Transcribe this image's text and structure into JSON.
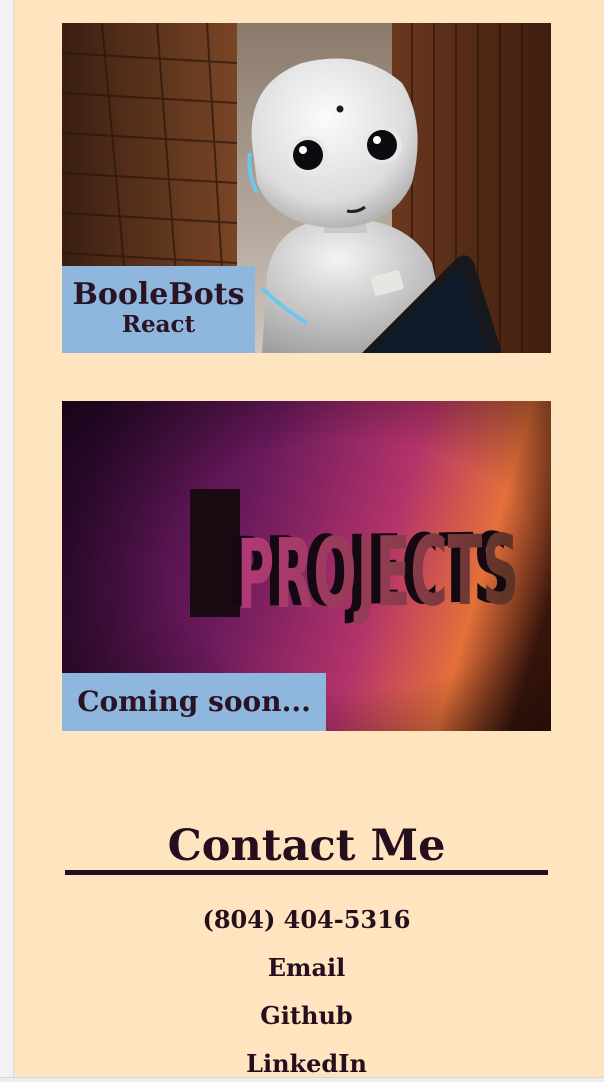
{
  "projects": [
    {
      "title": "BooleBots",
      "subtitle": "React",
      "image_alt": "White humanoid robot with large round eyes"
    },
    {
      "title": "Coming soon...",
      "image_alt": "PROJECTS lettering on a purple-orange wall"
    }
  ],
  "contact": {
    "heading": "Contact Me",
    "items": [
      {
        "label": "(804) 404-5316"
      },
      {
        "label": "Email"
      },
      {
        "label": "Github"
      },
      {
        "label": "LinkedIn"
      }
    ]
  },
  "colors": {
    "page_background": "#ffe4c0",
    "caption_background": "#8fb7de",
    "text_dark": "#250f1f"
  }
}
